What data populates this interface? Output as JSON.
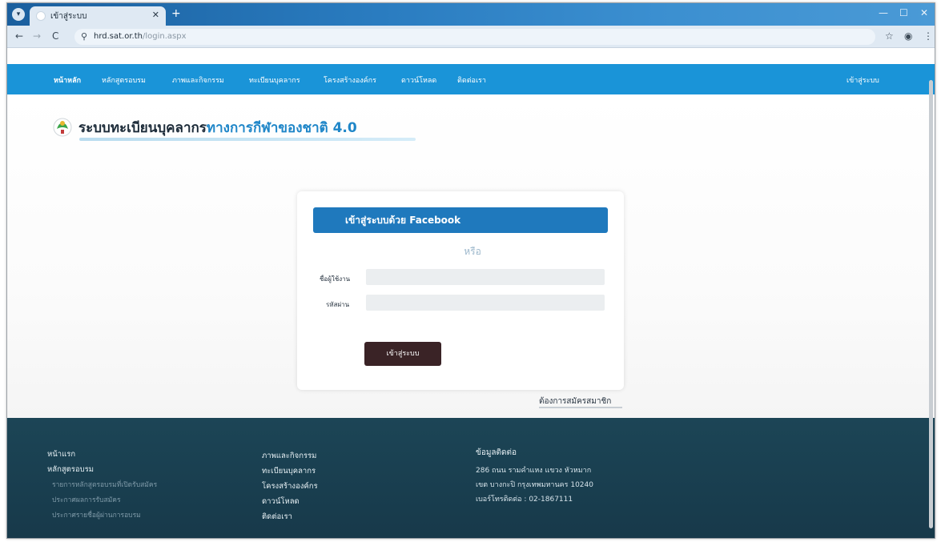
{
  "browser": {
    "tab_title": "เข้าสู่ระบบ",
    "url_host": "hrd.sat.or.th",
    "url_path": "/login.aspx"
  },
  "nav": {
    "items": [
      "หน้าหลัก",
      "หลักสูตรอบรม",
      "ภาพและกิจกรรม",
      "ทะเบียนบุคลากร",
      "โครงสร้างองค์กร",
      "ดาวน์โหลด",
      "ติดต่อเรา"
    ],
    "login": "เข้าสู่ระบบ"
  },
  "brand": {
    "title_main": "ระบบทะเบียนบุคลากร",
    "title_accent": "ทางการกีฬาของชาติ 4.0"
  },
  "login": {
    "facebook_label": "เข้าสู่ระบบด้วย Facebook",
    "or_label": "หรือ",
    "username_label": "ชื่อผู้ใช้งาน",
    "password_label": "รหัสผ่าน",
    "submit_label": "เข้าสู่ระบบ",
    "signup_label": "ต้องการสมัครสมาชิก"
  },
  "footer": {
    "col1": {
      "home": "หน้าแรก",
      "courses": "หลักสูตรอบรม",
      "sub": [
        "รายการหลักสูตรอบรมที่เปิดรับสมัคร",
        "ประกาศผลการรับสมัคร",
        "ประกาศรายชื่อผู้ผ่านการอบรม"
      ]
    },
    "col2": [
      "ภาพและกิจกรรม",
      "ทะเบียนบุคลากร",
      "โครงสร้างองค์กร",
      "ดาวน์โหลด",
      "ติดต่อเรา"
    ],
    "contact": {
      "title": "ข้อมูลติดต่อ",
      "address1": "286 ถนน รามคำแหง แขวง หัวหมาก",
      "address2": "เขต บางกะปิ กรุงเทพมหานคร 10240",
      "phone": "เบอร์โทรติดต่อ : 02-1867111"
    }
  }
}
